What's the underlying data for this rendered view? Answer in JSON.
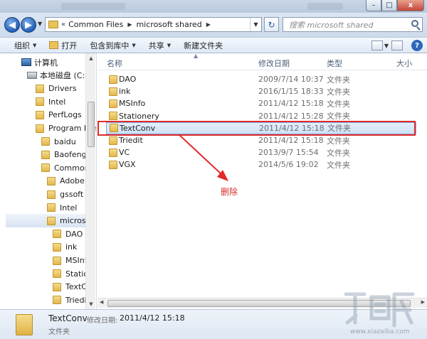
{
  "window": {
    "minimize_glyph": "–",
    "maximize_glyph": "□",
    "close_glyph": "x"
  },
  "address": {
    "chevron": "«",
    "crumbs": [
      "Common Files",
      "microsoft shared"
    ],
    "search_placeholder": "搜索 microsoft shared"
  },
  "toolbar": {
    "organize": "组织",
    "open": "打开",
    "include_in_library": "包含到库中",
    "share": "共享",
    "new_folder": "新建文件夹",
    "help": "?"
  },
  "nav_tree": [
    {
      "label": "计算机",
      "icon": "computer-icon"
    },
    {
      "label": "本地磁盘 (C:)",
      "icon": "disk-icon"
    },
    {
      "label": "Drivers",
      "icon": "folder-icon"
    },
    {
      "label": "Intel",
      "icon": "folder-icon"
    },
    {
      "label": "PerfLogs",
      "icon": "folder-icon"
    },
    {
      "label": "Program File",
      "icon": "folder-icon"
    },
    {
      "label": "baidu",
      "icon": "folder-icon"
    },
    {
      "label": "Baofeng",
      "icon": "folder-icon"
    },
    {
      "label": "Common I",
      "icon": "folder-icon"
    },
    {
      "label": "Adobe",
      "icon": "folder-icon"
    },
    {
      "label": "gssoft",
      "icon": "folder-icon"
    },
    {
      "label": "Intel",
      "icon": "folder-icon"
    },
    {
      "label": "microsof",
      "icon": "folder-icon",
      "selected": true
    },
    {
      "label": "DAO",
      "icon": "folder-icon"
    },
    {
      "label": "ink",
      "icon": "folder-icon"
    },
    {
      "label": "MSInfo",
      "icon": "folder-icon"
    },
    {
      "label": "Station",
      "icon": "folder-icon"
    },
    {
      "label": "TextCo",
      "icon": "folder-icon"
    },
    {
      "label": "Triedit",
      "icon": "folder-icon"
    }
  ],
  "columns": {
    "name": "名称",
    "modified": "修改日期",
    "type": "类型",
    "size": "大小"
  },
  "files": [
    {
      "name": "DAO",
      "date": "2009/7/14 10:37",
      "type": "文件夹"
    },
    {
      "name": "ink",
      "date": "2016/1/15 18:33",
      "type": "文件夹"
    },
    {
      "name": "MSInfo",
      "date": "2011/4/12 15:18",
      "type": "文件夹"
    },
    {
      "name": "Stationery",
      "date": "2011/4/12 15:28",
      "type": "文件夹"
    },
    {
      "name": "TextConv",
      "date": "2011/4/12 15:18",
      "type": "文件夹",
      "selected": true
    },
    {
      "name": "Triedit",
      "date": "2011/4/12 15:18",
      "type": "文件夹"
    },
    {
      "name": "VC",
      "date": "2013/9/7 15:54",
      "type": "文件夹"
    },
    {
      "name": "VGX",
      "date": "2014/5/6 19:02",
      "type": "文件夹"
    }
  ],
  "annotation": {
    "label": "删除",
    "color": "#e12b2b"
  },
  "details": {
    "name": "TextConv",
    "date_label": "修改日期:",
    "date": "2011/4/12 15:18",
    "type": "文件夹"
  },
  "watermark": {
    "text": "www.xiazaiba.com"
  }
}
